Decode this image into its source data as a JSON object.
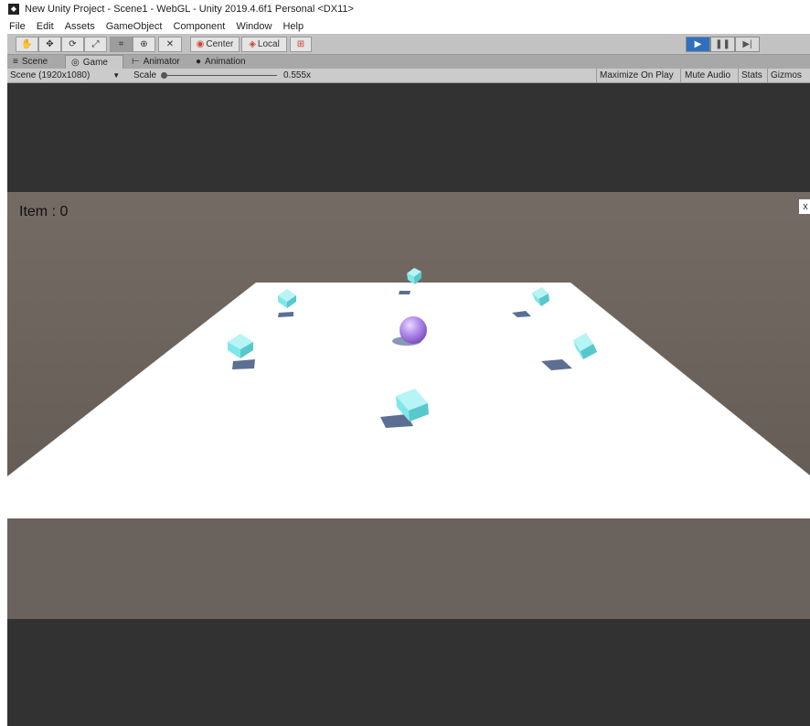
{
  "window": {
    "title": "New Unity Project - Scene1 - WebGL - Unity 2019.4.6f1 Personal <DX11>"
  },
  "menu": [
    "File",
    "Edit",
    "Assets",
    "GameObject",
    "Component",
    "Window",
    "Help"
  ],
  "toolbar": {
    "tools": [
      "hand-tool-icon",
      "move-tool-icon",
      "rotate-tool-icon",
      "scale-tool-icon",
      "rect-tool-icon",
      "transform-tool-icon",
      "custom-tool-icon"
    ],
    "pivot_label": "Center",
    "space_label": "Local",
    "play": {
      "state": "playing",
      "accent": "#2f6fc2"
    }
  },
  "tabs": [
    {
      "label": "Scene",
      "icon": "scene-icon"
    },
    {
      "label": "Game",
      "icon": "gamepad-icon",
      "active": true
    },
    {
      "label": "Animator",
      "icon": "animator-icon"
    },
    {
      "label": "Animation",
      "icon": "animation-icon"
    }
  ],
  "game_bar": {
    "display": "Scene (1920x1080)",
    "scale_label": "Scale",
    "scale_value": "0.555x",
    "maximize": "Maximize On Play",
    "mute": "Mute Audio",
    "stats": "Stats",
    "gizmos": "Gizmos"
  },
  "game_view": {
    "hud_text": "Item : 0",
    "close_glyph": "x",
    "colors": {
      "background": "#323232",
      "sky": "#686058",
      "ground": "#ffffff",
      "pickup": "#7fe7ea",
      "player": "#b893ee"
    },
    "pickups_remaining": 7
  }
}
